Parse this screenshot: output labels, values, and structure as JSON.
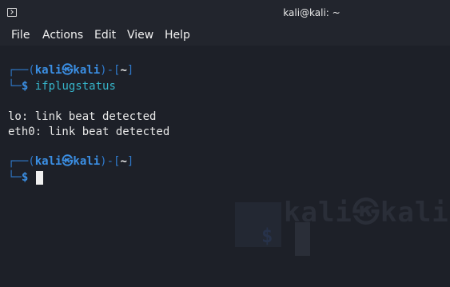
{
  "window": {
    "title": "kali@kali: ~",
    "icon": "terminal-icon"
  },
  "menu": {
    "items": [
      "File",
      "Actions",
      "Edit",
      "View",
      "Help"
    ]
  },
  "terminal": {
    "prompt1": {
      "frame_top": "┌──(",
      "user": "kali㉿kali",
      "bracket_mid": ")-[",
      "cwd": "~",
      "bracket_end": "]",
      "frame_bottom": "└─",
      "dollar": "$",
      "command": " ifplugstatus"
    },
    "output": [
      "lo: link beat detected",
      "eth0: link beat detected"
    ],
    "prompt2": {
      "frame_top": "┌──(",
      "user": "kali㉿kali",
      "bracket_mid": ")-[",
      "cwd": "~",
      "bracket_end": "]",
      "frame_bottom": "└─",
      "dollar": "$"
    },
    "watermark": {
      "text": "kali㉿kali",
      "dollar": "$"
    }
  },
  "colors": {
    "background": "#1d2028",
    "prompt_blue": "#3b8fe4",
    "command_cyan": "#36b5ca"
  }
}
